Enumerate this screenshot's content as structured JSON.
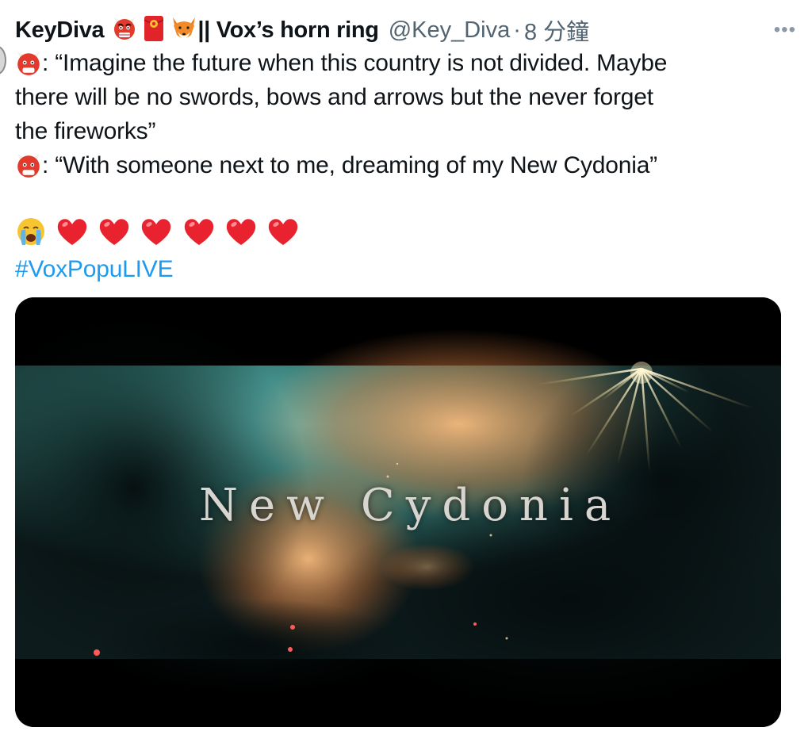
{
  "tweet": {
    "display_name_start": "KeyDiva",
    "display_name_end": "|| Vox’s horn ring",
    "name_icons": [
      "ogre-icon",
      "red-envelope-icon",
      "fox-icon"
    ],
    "handle": "@Key_Diva",
    "separator": "·",
    "time": "8 分鐘",
    "more_label": "•••",
    "body_lines": [
      ": “Imagine the future when this country is not divided. Maybe",
      "there will be no swords, bows and arrows but the never forget",
      "the fireworks”",
      ": “With someone next to me, dreaming of my New Cydonia”"
    ],
    "emoji_line": [
      "crying-face-icon",
      "red-heart-icon",
      "red-heart-icon",
      "red-heart-icon",
      "red-heart-icon",
      "red-heart-icon",
      "red-heart-icon"
    ],
    "hashtag": "#VoxPopuLIVE"
  },
  "media": {
    "caption": "New Cydonia"
  }
}
